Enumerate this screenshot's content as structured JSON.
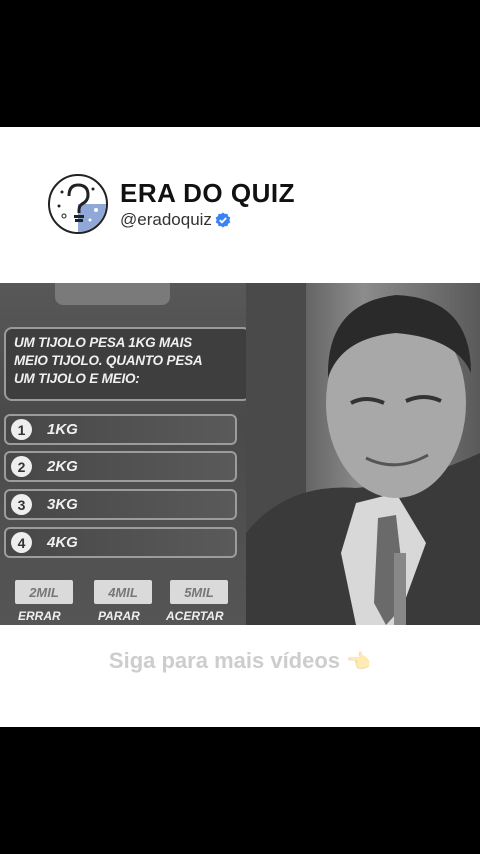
{
  "account": {
    "name": "ERA DO QUIZ",
    "handle": "@eradoquiz",
    "avatar_icon": "question-mark-bulb-icon",
    "verified_icon": "verified-badge-icon",
    "verified_color": "#3b82f6"
  },
  "quiz": {
    "question_lines": [
      "UM TIJOLO PESA 1KG MAIS",
      "MEIO TIJOLO. QUANTO PESA",
      "UM TIJOLO E MEIO:"
    ],
    "options": [
      {
        "number": "1",
        "text": "1KG"
      },
      {
        "number": "2",
        "text": "2KG"
      },
      {
        "number": "3",
        "text": "3KG"
      },
      {
        "number": "4",
        "text": "4KG"
      }
    ],
    "prizes": [
      {
        "amount": "2MIL",
        "label": "ERRAR"
      },
      {
        "amount": "4MIL",
        "label": "PARAR"
      },
      {
        "amount": "5MIL",
        "label": "ACERTAR"
      }
    ]
  },
  "caption": {
    "text": "Siga para mais vídeos",
    "icon": "pointing-hand-icon"
  }
}
